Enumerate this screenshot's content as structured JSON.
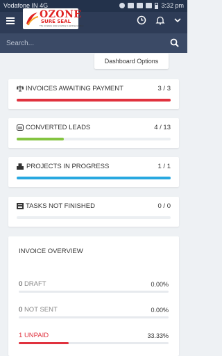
{
  "status_bar": {
    "carrier": "Vodafone IN",
    "network": "4G",
    "time": "3:32 pm"
  },
  "header": {
    "logo": {
      "title": "OZONE",
      "subtitle": "SURE SEAL",
      "tagline": "The complete water proofing & painting solution"
    },
    "icons": [
      "menu-icon",
      "clock-icon",
      "bell-icon",
      "dropdown-chevron-icon"
    ]
  },
  "search": {
    "placeholder": "Search..."
  },
  "dashboard_options_label": "Dashboard Options",
  "stats": [
    {
      "label": "INVOICES AWAITING PAYMENT",
      "value": "3 / 3",
      "fraction": 1.0,
      "color": "#e0323e",
      "icon": "scale-icon"
    },
    {
      "label": "CONVERTED LEADS",
      "value": "4 / 13",
      "fraction": 0.3077,
      "color": "#84c441",
      "icon": "leads-icon"
    },
    {
      "label": "PROJECTS IN PROGRESS",
      "value": "1 / 1",
      "fraction": 1.0,
      "color": "#28a8e0",
      "icon": "cubes-icon"
    },
    {
      "label": "TASKS NOT FINISHED",
      "value": "0 / 0",
      "fraction": 0,
      "color": "#9aa3ad",
      "icon": "tasks-icon"
    }
  ],
  "invoice_overview": {
    "title": "INVOICE OVERVIEW",
    "rows": [
      {
        "count": "0",
        "label": "DRAFT",
        "percent": "0.00%",
        "fraction": 0,
        "color": "#888888",
        "bar_color": "#777777"
      },
      {
        "count": "0",
        "label": "NOT SENT",
        "percent": "0.00%",
        "fraction": 0,
        "color": "#888888",
        "bar_color": "#777777"
      },
      {
        "count": "1",
        "label": "UNPAID",
        "percent": "33.33%",
        "fraction": 0.3333,
        "color": "#e0323e",
        "bar_color": "#e0323e"
      }
    ]
  }
}
